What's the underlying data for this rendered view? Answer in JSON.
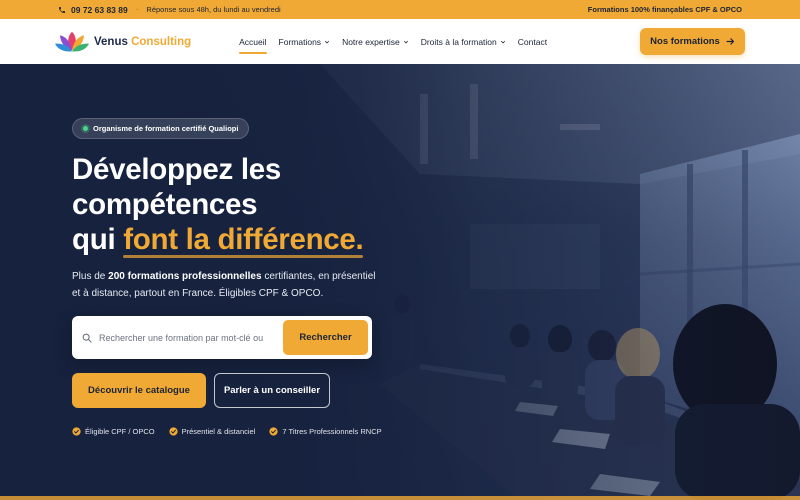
{
  "topbar": {
    "phone": "09 72 63 83 89",
    "separator": "·",
    "hours": "Réponse sous 48h, du lundi au vendredi",
    "funding": "Formations 100% finançables CPF & OPCO"
  },
  "header": {
    "brand_part1": "Venus",
    "brand_part2": "Consulting",
    "nav": [
      {
        "label": "Accueil"
      },
      {
        "label": "Formations"
      },
      {
        "label": "Notre expertise"
      },
      {
        "label": "Droits à la formation"
      },
      {
        "label": "Contact"
      }
    ],
    "cta": "Nos formations"
  },
  "hero": {
    "badge": "Organisme de formation certifié Qualiopi",
    "title_line1": "Développez les",
    "title_line2": "compétences",
    "title_line3a": "qui",
    "title_line3b": "font la différence.",
    "lead_pre": "Plus de",
    "lead_bold": "200 formations professionnelles",
    "lead_post": "certifiantes, en présentiel et à distance, partout en France. Éligibles CPF & OPCO.",
    "search_placeholder": "Rechercher une formation par mot-clé ou",
    "search_button": "Rechercher",
    "btn_catalog": "Découvrir le catalogue",
    "btn_advisor": "Parler à un conseiller",
    "checks": [
      {
        "label": "Éligible CPF / OPCO"
      },
      {
        "label": "Présentiel & distanciel"
      },
      {
        "label": "7 Titres Professionnels RNCP"
      }
    ]
  },
  "colors": {
    "accent": "#f1a935",
    "navy": "#1b2a4a",
    "hero_overlay": "#16223e"
  },
  "icons": [
    "phone-icon",
    "chevron-down-icon",
    "arrow-right-icon",
    "search-icon",
    "check-badge-icon",
    "logo-lotus-icon"
  ]
}
